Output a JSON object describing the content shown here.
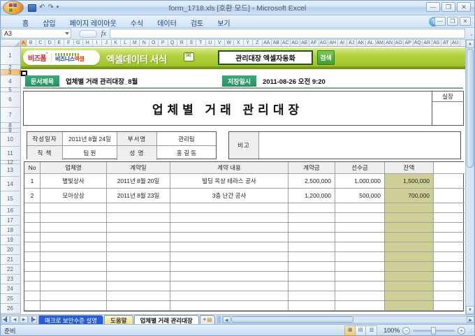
{
  "window": {
    "title": "form_1718.xls  [호환 모드] - Microsoft Excel"
  },
  "ribbon": {
    "tabs": [
      "홈",
      "삽입",
      "페이지 레이아웃",
      "수식",
      "데이터",
      "검토",
      "보기"
    ]
  },
  "formula_bar": {
    "name_box": "A3",
    "fx_label": "fx",
    "value": ""
  },
  "grid": {
    "selected_cell": "A3",
    "selected_column": "A",
    "selected_row": "3",
    "column_headers": [
      "A",
      "B",
      "C",
      "D",
      "E",
      "F",
      "G",
      "H",
      "I",
      "J",
      "K",
      "L",
      "M",
      "N",
      "O",
      "P",
      "Q",
      "R",
      "S",
      "T",
      "U",
      "V",
      "W",
      "X",
      "Y",
      "Z",
      "AA",
      "AB",
      "AC",
      "AD",
      "AE",
      "AF",
      "AG",
      "AH",
      "AI",
      "AJ",
      "AK",
      "AL",
      "AM",
      "AN",
      "AO",
      "AP",
      "AQ",
      "AR",
      "AS",
      "AT",
      "AU"
    ],
    "row_headers": [
      "1",
      "2",
      "3",
      "4",
      "5",
      "6",
      "7",
      "8",
      "9",
      "10",
      "11",
      "12",
      "13",
      "14",
      "15",
      "16",
      "17",
      "18",
      "19",
      "20",
      "21",
      "22",
      "23",
      "24",
      "25",
      "26"
    ]
  },
  "banner": {
    "logo_bizform": "비즈폼",
    "logo_biznis": "비즈니스",
    "logo_excel": "엑셀",
    "title": "엑셀데이터 서식",
    "search_value": "관리대장 엑셀자동화",
    "search_button": "검색"
  },
  "doc_info": {
    "doc_title_label": "문서제목",
    "doc_title_value": "업체별 거래 관리대장_8월",
    "saved_label": "저장일시",
    "saved_value": "2011-08-26  오전 9:20"
  },
  "form": {
    "main_title": "업체별 거래 관리대장",
    "approval_label": "실장",
    "info": {
      "date_label": "작성일자",
      "date_value": "2011년 8월 24일",
      "dept_label": "부서명",
      "dept_value": "관리팀",
      "position_label": "직  책",
      "position_value": "팀 원",
      "name_label": "성  명",
      "name_value": "홍 길 동",
      "note_label": "비고",
      "note_value": ""
    },
    "table": {
      "headers": [
        "No",
        "업체명",
        "계약일",
        "계약 내용",
        "계약금",
        "선수금",
        "잔액"
      ],
      "rows": [
        [
          "1",
          "별빛상사",
          "2011년 8월 20일",
          "빌딩 옥상 테라스 공사",
          "2,500,000",
          "1,000,000",
          "1,500,000"
        ],
        [
          "2",
          "모아상상",
          "2011년 8월 23일",
          "3층 난간 공사",
          "1,200,000",
          "500,000",
          "700,000"
        ]
      ],
      "empty_row_count": 11
    }
  },
  "sheet_tabs": {
    "tabs": [
      {
        "label": "매크로 보안수준 설명",
        "state": "highlighted"
      },
      {
        "label": "도움말",
        "state": "inactive"
      },
      {
        "label": "업체별 거래 관리대장",
        "state": "active"
      }
    ]
  },
  "status_bar": {
    "ready": "준비",
    "zoom": "100%"
  },
  "colors": {
    "banner_green": "#a2c72c",
    "label_green": "#2f9d6e",
    "balance_khaki": "#cecf97",
    "selected_tab_blue": "#2a5bd7",
    "search_button_green": "#4aa73c",
    "header_select_orange": "#f6b968"
  }
}
